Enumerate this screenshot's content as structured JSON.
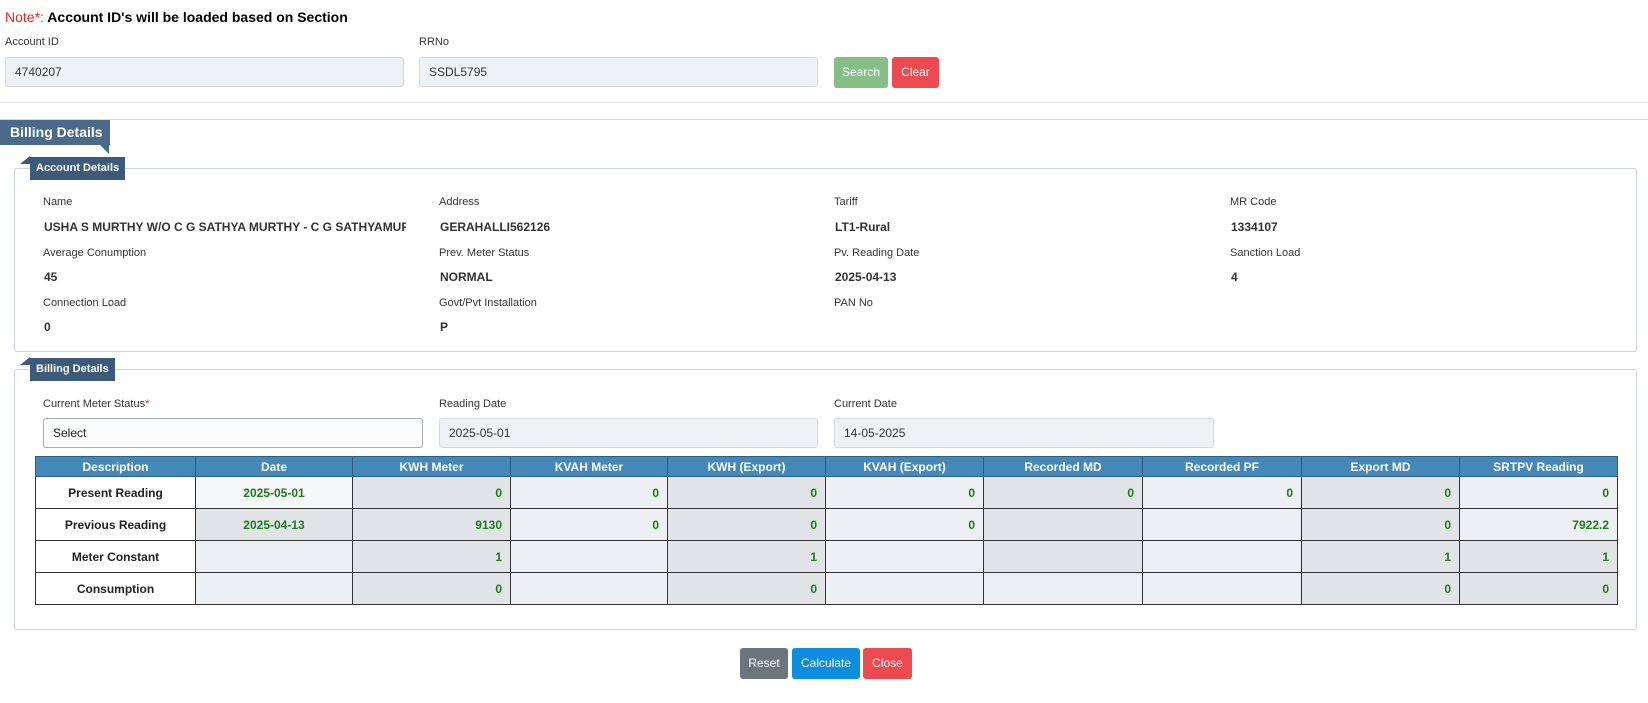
{
  "note": {
    "prefix": "Note*:",
    "text": " Account ID's will be loaded based on Section"
  },
  "search": {
    "account_id_label": "Account ID",
    "account_id_value": "4740207",
    "rrno_label": "RRNo",
    "rrno_value": "SSDL5795",
    "search_label": "Search",
    "clear_label": "Clear"
  },
  "billing_tab": "Billing Details",
  "account_details": {
    "legend": "Account Details",
    "fields": [
      {
        "label": "Name",
        "value": "USHA S MURTHY W/O C G SATHYA MURTHY - C G SATHYAMURTH"
      },
      {
        "label": "Address",
        "value": "GERAHALLI562126"
      },
      {
        "label": "Tariff",
        "value": "LT1-Rural"
      },
      {
        "label": "MR Code",
        "value": "1334107"
      },
      {
        "label": "Average Conumption",
        "value": "45"
      },
      {
        "label": "Prev. Meter Status",
        "value": "NORMAL"
      },
      {
        "label": "Pv. Reading Date",
        "value": "2025-04-13"
      },
      {
        "label": "Sanction Load",
        "value": "4"
      },
      {
        "label": "Connection Load",
        "value": "0"
      },
      {
        "label": "Govt/Pvt Installation",
        "value": "P"
      },
      {
        "label": "PAN No",
        "value": ""
      }
    ]
  },
  "billing_details": {
    "legend": "Billing Details",
    "meter_status_label": "Current Meter Status",
    "meter_status_req": "*",
    "meter_status_value": "Select",
    "reading_date_label": "Reading Date",
    "reading_date_value": "2025-05-01",
    "current_date_label": "Current Date",
    "current_date_value": "14-05-2025"
  },
  "table": {
    "headers": [
      "Description",
      "Date",
      "KWH Meter",
      "KVAH Meter",
      "KWH (Export)",
      "KVAH (Export)",
      "Recorded MD",
      "Recorded PF",
      "Export MD",
      "SRTPV Reading"
    ],
    "rows": [
      [
        "Present Reading",
        "2025-05-01",
        "0",
        "0",
        "0",
        "0",
        "0",
        "0",
        "0",
        "0"
      ],
      [
        "Previous Reading",
        "2025-04-13",
        "9130",
        "0",
        "0",
        "0",
        "",
        "",
        "0",
        "7922.2"
      ],
      [
        "Meter Constant",
        "",
        "1",
        "",
        "1",
        "",
        "",
        "",
        "1",
        "1"
      ],
      [
        "Consumption",
        "",
        "0",
        "",
        "0",
        "",
        "",
        "",
        "0",
        "0"
      ]
    ]
  },
  "footer": {
    "reset_label": "Reset",
    "calculate_label": "Calculate",
    "close_label": "Close"
  },
  "colors": {
    "search": "#85bf85",
    "clear": "#ec4a4f",
    "reset": "#6c757d",
    "calculate": "#0d8de0",
    "close": "#ec4a4f",
    "header": "#4388b8"
  }
}
